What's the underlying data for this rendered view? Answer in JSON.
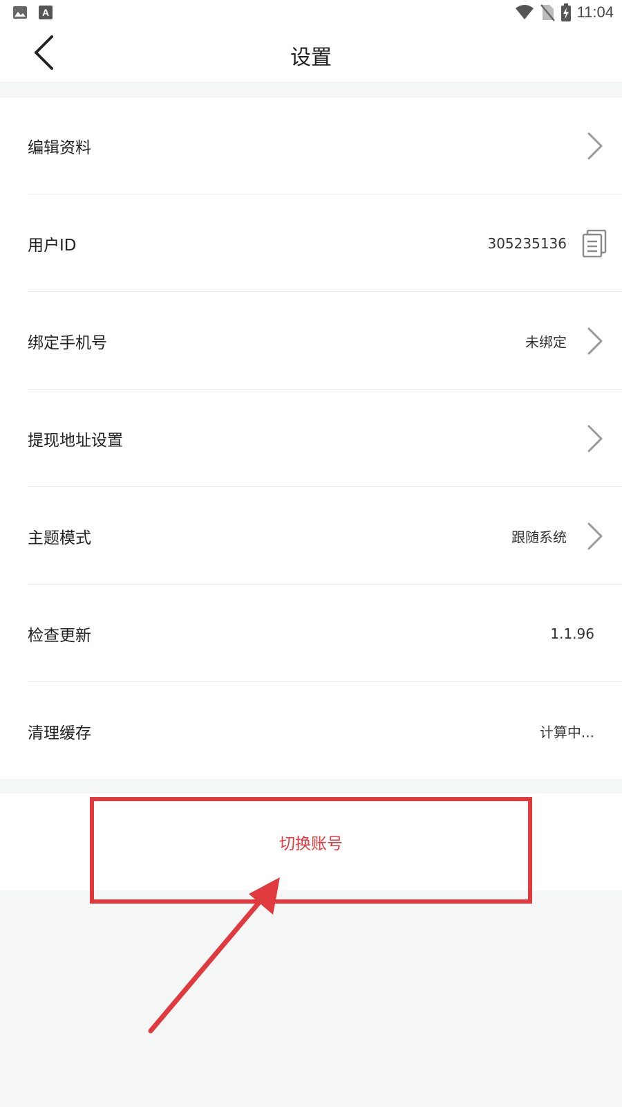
{
  "status_bar": {
    "time": "11:04",
    "left_icons": [
      "image-icon",
      "font-icon"
    ],
    "right_icons": [
      "wifi-icon",
      "no-sim-icon",
      "battery-charging-icon"
    ]
  },
  "header": {
    "title": "设置",
    "back_icon": "chevron-left-icon"
  },
  "settings": {
    "edit_profile": {
      "label": "编辑资料"
    },
    "user_id": {
      "label": "用户ID",
      "value": "305235136"
    },
    "bind_phone": {
      "label": "绑定手机号",
      "value": "未绑定"
    },
    "withdraw_address": {
      "label": "提现地址设置"
    },
    "theme_mode": {
      "label": "主题模式",
      "value": "跟随系统"
    },
    "check_update": {
      "label": "检查更新",
      "value": "1.1.96"
    },
    "clear_cache": {
      "label": "清理缓存",
      "value": "计算中..."
    }
  },
  "switch_account": {
    "label": "切换账号"
  },
  "colors": {
    "accent_red": "#e53b3e",
    "annotation_red": "#e03a3e",
    "page_background": "#f5f6f6"
  }
}
